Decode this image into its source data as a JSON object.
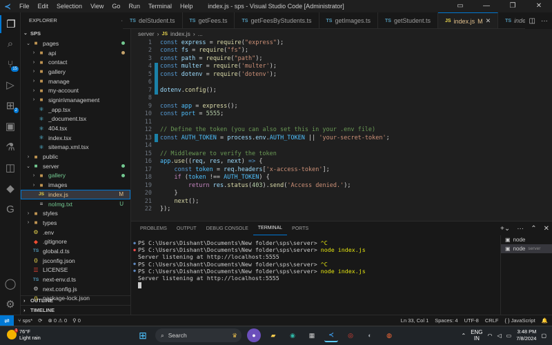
{
  "app": {
    "title": "index.js - sps - Visual Studio Code [Administrator]",
    "menu": [
      "File",
      "Edit",
      "Selection",
      "View",
      "Go",
      "Run",
      "Terminal",
      "Help"
    ]
  },
  "explorer": {
    "header": "EXPLORER",
    "root": "SPS",
    "outline": "OUTLINE",
    "timeline": "TIMELINE",
    "tree": [
      {
        "label": "pages",
        "kind": "folder",
        "open": true,
        "depth": 0,
        "dot": "#73c991"
      },
      {
        "label": "api",
        "kind": "folder",
        "open": false,
        "depth": 1,
        "dot": "#c5a36b"
      },
      {
        "label": "contact",
        "kind": "folder",
        "open": false,
        "depth": 1
      },
      {
        "label": "gallery",
        "kind": "folder",
        "open": false,
        "depth": 1
      },
      {
        "label": "manage",
        "kind": "folder",
        "open": false,
        "depth": 1
      },
      {
        "label": "my-account",
        "kind": "folder",
        "open": false,
        "depth": 1
      },
      {
        "label": "signin\\management",
        "kind": "folder",
        "open": false,
        "depth": 1
      },
      {
        "label": "_app.tsx",
        "kind": "react",
        "depth": 1
      },
      {
        "label": "_document.tsx",
        "kind": "react",
        "depth": 1
      },
      {
        "label": "404.tsx",
        "kind": "react",
        "depth": 1
      },
      {
        "label": "index.tsx",
        "kind": "react",
        "depth": 1
      },
      {
        "label": "sitemap.xml.tsx",
        "kind": "react",
        "depth": 1
      },
      {
        "label": "public",
        "kind": "folder",
        "open": false,
        "depth": 0
      },
      {
        "label": "server",
        "kind": "folder-green",
        "open": true,
        "depth": 0,
        "dot": "#73c991"
      },
      {
        "label": "gallery",
        "kind": "folder",
        "open": false,
        "depth": 1,
        "dot": "#73c991",
        "color": "#73c991"
      },
      {
        "label": "images",
        "kind": "folder",
        "open": false,
        "depth": 1
      },
      {
        "label": "index.js",
        "kind": "js",
        "depth": 1,
        "status": "M",
        "color": "#e2c08d",
        "selected": true
      },
      {
        "label": "noImg.txt",
        "kind": "txt",
        "depth": 1,
        "status": "U",
        "color": "#73c991"
      },
      {
        "label": "styles",
        "kind": "folder",
        "open": false,
        "depth": 0
      },
      {
        "label": "types",
        "kind": "folder",
        "open": false,
        "depth": 0
      },
      {
        "label": ".env",
        "kind": "env",
        "depth": 0
      },
      {
        "label": ".gitignore",
        "kind": "git",
        "depth": 0
      },
      {
        "label": "global.d.ts",
        "kind": "ts",
        "depth": 0
      },
      {
        "label": "jsconfig.json",
        "kind": "json",
        "depth": 0
      },
      {
        "label": "LICENSE",
        "kind": "license",
        "depth": 0
      },
      {
        "label": "next-env.d.ts",
        "kind": "ts",
        "depth": 0
      },
      {
        "label": "next.config.js",
        "kind": "gear",
        "depth": 0
      },
      {
        "label": "package-lock.json",
        "kind": "json",
        "depth": 0
      }
    ]
  },
  "tabs": [
    {
      "label": "delStudent.ts",
      "kind": "ts"
    },
    {
      "label": "getFees.ts",
      "kind": "ts"
    },
    {
      "label": "getFeesByStudents.ts",
      "kind": "ts"
    },
    {
      "label": "getImages.ts",
      "kind": "ts"
    },
    {
      "label": "getStudent.ts",
      "kind": "ts"
    },
    {
      "label": "index.js",
      "kind": "js",
      "active": true,
      "mark": "M"
    },
    {
      "label": "index.ts",
      "kind": "ts",
      "italic": true
    }
  ],
  "breadcrumb": {
    "folder": "server",
    "file": "index.js",
    "rest": "..."
  },
  "code": [
    {
      "n": "1",
      "html": "<span class='kw'>const</span> <span class='var'>express</span> <span class='pl'>= </span><span class='fn'>require</span><span class='pl'>(</span><span class='str'>\"express\"</span><span class='pl'>);</span>"
    },
    {
      "n": "2",
      "html": "<span class='kw'>const</span> <span class='var'>fs</span> <span class='pl'>= </span><span class='fn'>require</span><span class='pl'>(</span><span class='str'>\"fs\"</span><span class='pl'>);</span>"
    },
    {
      "n": "3",
      "html": "<span class='kw'>const</span> <span class='var'>path</span> <span class='pl'>= </span><span class='fn'>require</span><span class='pl'>(</span><span class='str'>\"path\"</span><span class='pl'>);</span>"
    },
    {
      "n": "4",
      "html": "<span class='kw'>const</span> <span class='var'>multer</span> <span class='pl'>= </span><span class='fn'>require</span><span class='pl'>(</span><span class='str'>'multer'</span><span class='pl'>);</span>",
      "mod": true
    },
    {
      "n": "5",
      "html": "<span class='kw'>const</span> <span class='var'>dotenv</span> <span class='pl'>= </span><span class='fn'>require</span><span class='pl'>(</span><span class='str'>'dotenv'</span><span class='pl'>);</span>",
      "mod": true
    },
    {
      "n": "6",
      "html": "",
      "mod": true
    },
    {
      "n": "7",
      "html": "<span class='var'>dotenv</span><span class='pl'>.</span><span class='fn'>config</span><span class='pl'>();</span>",
      "mod": true
    },
    {
      "n": "8",
      "html": ""
    },
    {
      "n": "9",
      "html": "<span class='kw'>const</span> <span class='const'>app</span> <span class='pl'>= </span><span class='fn'>express</span><span class='pl'>();</span>"
    },
    {
      "n": "10",
      "html": "<span class='kw'>const</span> <span class='const'>port</span> <span class='pl'>= </span><span class='num'>5555</span><span class='pl'>;</span>"
    },
    {
      "n": "11",
      "html": ""
    },
    {
      "n": "12",
      "html": "<span class='cmt'>// Define the token (you can also set this in your .env file)</span>"
    },
    {
      "n": "13",
      "html": "<span class='kw'>const</span> <span class='const'>AUTH_TOKEN</span> <span class='pl'>= </span><span class='var'>process</span><span class='pl'>.</span><span class='var'>env</span><span class='pl'>.</span><span class='const'>AUTH_TOKEN</span> <span class='pl'>|| </span><span class='str'>'your-secret-token'</span><span class='pl'>;</span>",
      "mod": true
    },
    {
      "n": "14",
      "html": ""
    },
    {
      "n": "15",
      "html": "<span class='cmt'>// Middleware to verify the token</span>"
    },
    {
      "n": "16",
      "html": "<span class='const'>app</span><span class='pl'>.</span><span class='fn'>use</span><span class='pl'>((</span><span class='var'>req</span><span class='pl'>, </span><span class='var'>res</span><span class='pl'>, </span><span class='var'>next</span><span class='pl'>) </span><span class='kw'>=&gt;</span><span class='pl'> {</span>"
    },
    {
      "n": "17",
      "html": "    <span class='kw'>const</span> <span class='const'>token</span> <span class='pl'>= </span><span class='var'>req</span><span class='pl'>.</span><span class='var'>headers</span><span class='pl'>[</span><span class='str'>'x-access-token'</span><span class='pl'>];</span>"
    },
    {
      "n": "18",
      "html": "    <span class='kw2'>if</span><span class='pl'> (</span><span class='const'>token</span><span class='pl'> !== </span><span class='const'>AUTH_TOKEN</span><span class='pl'>) {</span>"
    },
    {
      "n": "19",
      "html": "        <span class='kw2'>return</span> <span class='var'>res</span><span class='pl'>.</span><span class='fn'>status</span><span class='pl'>(</span><span class='num'>403</span><span class='pl'>).</span><span class='fn'>send</span><span class='pl'>(</span><span class='str'>'Access denied.'</span><span class='pl'>);</span>"
    },
    {
      "n": "20",
      "html": "    <span class='pl'>}</span>"
    },
    {
      "n": "21",
      "html": "    <span class='fn'>next</span><span class='pl'>();</span>"
    },
    {
      "n": "22",
      "html": "<span class='pl'>});</span>"
    }
  ],
  "panel": {
    "tabs": [
      "PROBLEMS",
      "OUTPUT",
      "DEBUG CONSOLE",
      "TERMINAL",
      "PORTS"
    ],
    "active": "TERMINAL",
    "terminal_lines": [
      {
        "mark": "blue",
        "prompt": "PS C:\\Users\\Dishant\\Documents\\New folder\\sps\\server> ",
        "cmd": "^C"
      },
      {
        "mark": "red",
        "prompt": "PS C:\\Users\\Dishant\\Documents\\New folder\\sps\\server> ",
        "cmd": "node index.js"
      },
      {
        "mark": "",
        "prompt": "Server listening at http://localhost:5555",
        "cmd": ""
      },
      {
        "mark": "blue",
        "prompt": "PS C:\\Users\\Dishant\\Documents\\New folder\\sps\\server> ",
        "cmd": "^C"
      },
      {
        "mark": "blue",
        "prompt": "PS C:\\Users\\Dishant\\Documents\\New folder\\sps\\server> ",
        "cmd": "node index.js"
      },
      {
        "mark": "",
        "prompt": "Server listening at http://localhost:5555",
        "cmd": ""
      }
    ],
    "terminals": [
      {
        "label": "node",
        "sub": ""
      },
      {
        "label": "node",
        "sub": "server",
        "selected": true
      }
    ]
  },
  "status": {
    "branch": "sps*",
    "errors": "0",
    "warnings": "0",
    "ports": "0",
    "position": "Ln 33, Col 1",
    "spaces": "Spaces: 4",
    "encoding": "UTF-8",
    "eol": "CRLF",
    "language": "JavaScript"
  },
  "taskbar": {
    "temp": "76°F",
    "weather": "Light rain",
    "search_placeholder": "Search",
    "lang1": "ENG",
    "lang2": "IN",
    "time": "3:48 PM",
    "date": "7/8/2024"
  },
  "colors": {
    "accent": "#0078d4",
    "modified": "#e2c08d",
    "untracked": "#73c991"
  }
}
